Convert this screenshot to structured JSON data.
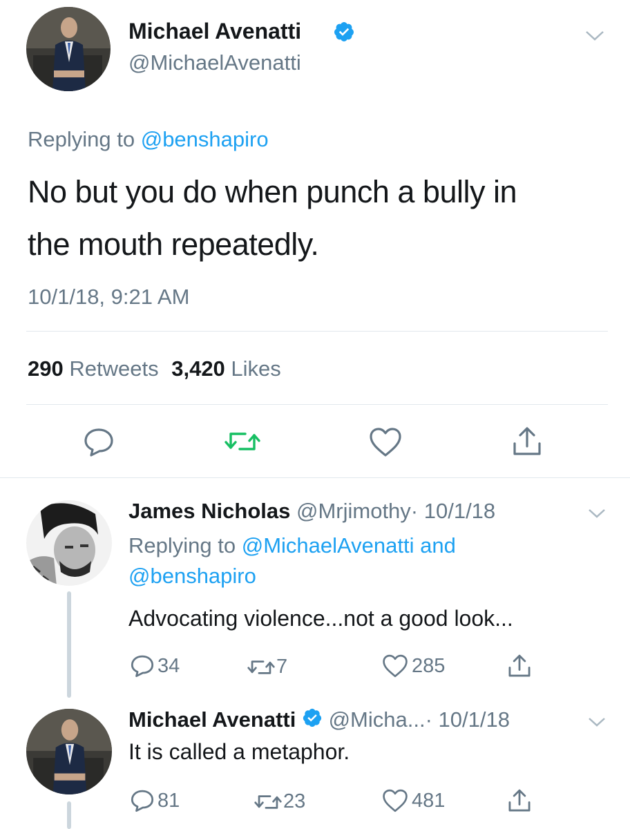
{
  "main_tweet": {
    "name": "Michael Avenatti",
    "handle": "@MichaelAvenatti",
    "replying_prefix": "Replying to",
    "replying_to": "@benshapiro",
    "text_line1": "No but you do when punch a bully in",
    "text_line2": "the mouth repeatedly.",
    "timestamp": "10/1/18, 9:21 AM",
    "retweets_count": "290",
    "retweets_label": "Retweets",
    "likes_count": "3,420",
    "likes_label": "Likes"
  },
  "reply1": {
    "name": "James Nicholas",
    "handle": "@Mrjimothy",
    "date": "· 10/1/18",
    "replying_prefix": "Replying to",
    "replying_to1": "@MichaelAvenatti",
    "replying_and": "and",
    "replying_to2": "@benshapiro",
    "text": "Advocating violence...not a good look...",
    "replies": "34",
    "retweets": "7",
    "likes": "285"
  },
  "reply2": {
    "name": "Michael Avenatti",
    "handle": "@Micha...",
    "date": "· 10/1/18",
    "text": "It is called a metaphor.",
    "replies": "81",
    "retweets": "23",
    "likes": "481"
  },
  "colors": {
    "accent": "#1da1f2",
    "retweet_active": "#17bf63",
    "muted": "#657786",
    "divider": "#e1e8ed"
  },
  "icons": [
    "verified-badge-icon",
    "chevron-down-icon",
    "reply-icon",
    "retweet-icon",
    "like-icon",
    "share-icon"
  ]
}
